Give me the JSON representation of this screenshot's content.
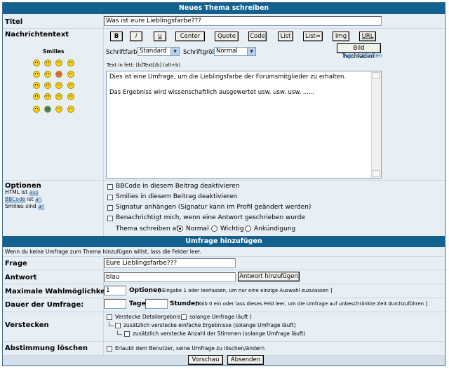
{
  "header": {
    "title": "Neues Thema schreiben"
  },
  "titel": {
    "label": "Titel",
    "value": "Was ist eure Lieblingsfarbe???"
  },
  "nachricht": {
    "label": "Nachrichtentext",
    "smilies_label": "Smilies",
    "buttons": [
      "B",
      "i",
      "u",
      "Center",
      "Quote",
      "Code",
      "List",
      "List=",
      "Img",
      "URL"
    ],
    "bild_hochladen": "Bild hochladen",
    "tags_schliessen": "Tags schließen",
    "schriftfarbe_label": "Schriftfarbe:",
    "schriftfarbe_value": "Standard",
    "schriftgroesse_label": "Schriftgröße:",
    "schriftgroesse_value": "Normal",
    "hint": "Text in fett: [b]Text[/b] (alt+b)",
    "body_line1": "Dies ist eine Umfrage, um die Lieblingsfarbe der Forumsmitglieder zu erhalten.",
    "body_line2": "Das Ergebniss wird wissenschaftlich ausgewertet usw. usw. usw. ......"
  },
  "optionen": {
    "label": "Optionen",
    "html_text": "HTML ist",
    "html_state": "aus",
    "bbcode_link": "BBCode",
    "bbcode_text": "ist",
    "bbcode_state": "an",
    "smilies_text": "Smilies sind",
    "smilies_state": "an",
    "items": [
      "BBCode in diesem Beitrag deaktivieren",
      "Smilies in diesem Beitrag deaktivieren",
      "Signatur anhängen (Signatur kann im Profil geändert werden)",
      "Benachrichtigt mich, wenn eine Antwort geschrieben wurde"
    ],
    "thema_label": "Thema schreiben als:",
    "thema_options": [
      "Normal",
      "Wichtig",
      "Ankündigung"
    ],
    "thema_selected": "Normal"
  },
  "umfrage": {
    "header": "Umfrage hinzufügen",
    "info": "Wenn du keine Umfrage zum Thema hinzufügen willst, lass die Felder leer.",
    "frage_label": "Frage",
    "frage_value": "Eure Lieblingsfarbe???",
    "antwort_label": "Antwort",
    "antwort_value": "blau",
    "antwort_button": "Antwort hinzufügen",
    "max_label": "Maximale Wahlmöglichkeiten",
    "max_value": "1",
    "max_unit": "Optionen",
    "max_hint": "[ Eingabe 1 oder leerlassen, um nur eine einzige Auswahl zuzulassen ]",
    "dauer_label": "Dauer der Umfrage:",
    "dauer_tage": "Tage",
    "dauer_stunden": "Stunden",
    "dauer_hint": "[ Gib 0 ein oder lass dieses Feld leer, um die Umfrage auf unbeschränkte Zeit durchzuführen ]",
    "verstecken_label": "Verstecken",
    "verstecken_1a": "Verstecke Detailergebnis (",
    "verstecken_1b": "solange Umfrage läuft )",
    "verstecken_2": "zusätzlich verstecke einfache Ergebnisse (solange Umfrage läuft)",
    "verstecken_3": "zusätzlich verstecke Anzahl der Stimmen (solange Umfrage läuft)",
    "loeschen_label": "Abstimmung löschen",
    "loeschen_text": "Erlaubt dem Benutzer, seine Umfrage zu löschen/ändern"
  },
  "footer": {
    "vorschau": "Vorschau",
    "absenden": "Absenden"
  }
}
